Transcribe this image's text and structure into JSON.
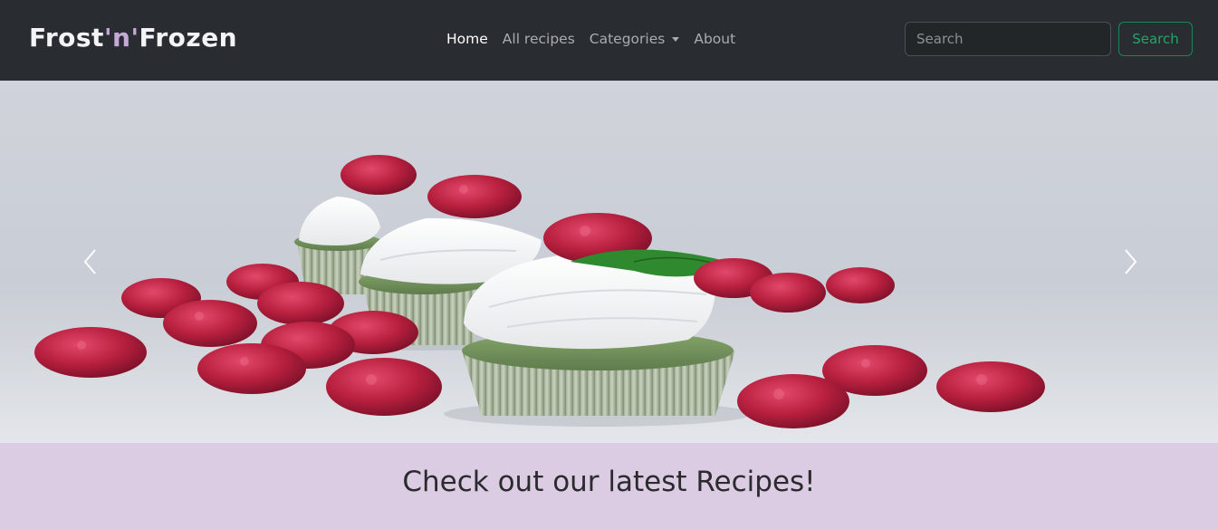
{
  "brand": {
    "part1": "Frost",
    "part2": "'n'",
    "part3": "Frozen"
  },
  "nav": {
    "items": [
      {
        "label": "Home",
        "active": true
      },
      {
        "label": "All recipes",
        "active": false
      },
      {
        "label": "Categories",
        "active": false,
        "dropdown": true
      },
      {
        "label": "About",
        "active": false
      }
    ]
  },
  "search": {
    "placeholder": "Search",
    "value": "",
    "button_label": "Search"
  },
  "carousel": {
    "image_subject": "raspberry-cupcakes",
    "prev_icon": "chevron-left-icon",
    "next_icon": "chevron-right-icon"
  },
  "section": {
    "title": "Check out our latest Recipes!"
  },
  "colors": {
    "navbar_bg": "#292d31",
    "brand_accent": "#c8a8d9",
    "search_button": "#198754",
    "section_bg": "#dbcce3",
    "raspberry": "#b8203f",
    "cupcake": "#7a9a63"
  }
}
